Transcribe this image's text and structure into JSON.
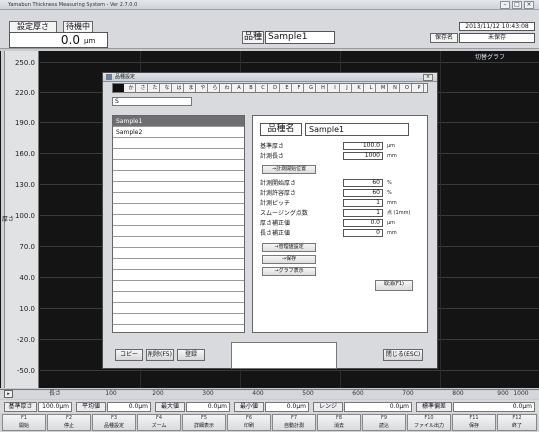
{
  "window": {
    "title": "Yamabun Thickness Measuring System - Ver 2.7.0.0"
  },
  "top": {
    "set_thickness_label": "設定厚さ",
    "set_thickness_value": "0.0",
    "set_thickness_unit": "μm",
    "state_badge": "待機中",
    "product_label": "品種",
    "product_value": "Sample1",
    "save_name_label": "保存名",
    "save_name_value": "未保存",
    "datetime": "2013/11/12 10:43:08",
    "graph_link": "切替グラフ"
  },
  "axis": {
    "y_title": "厚さ",
    "y_ticks": [
      "250.0",
      "220.0",
      "190.0",
      "160.0",
      "130.0",
      "100.0",
      "70.0",
      "40.0",
      "10.0",
      "-20.0",
      "-50.0"
    ],
    "x_title": "長さ",
    "x_ticks": [
      "100",
      "200",
      "300",
      "400",
      "500",
      "600",
      "700",
      "800",
      "900",
      "1000"
    ]
  },
  "status": [
    {
      "label": "基準厚さ",
      "value": "100.0μm"
    },
    {
      "label": "平均値",
      "value": "0.0μm"
    },
    {
      "label": "最大値",
      "value": "0.0μm"
    },
    {
      "label": "最小値",
      "value": "0.0μm"
    },
    {
      "label": "レンジ",
      "value": "0.0μm"
    },
    {
      "label": "標準偏差",
      "value": "0.0μm"
    }
  ],
  "fkeys": [
    {
      "n": "F1",
      "l": "開始"
    },
    {
      "n": "F2",
      "l": "停止"
    },
    {
      "n": "F3",
      "l": "品種設定"
    },
    {
      "n": "F4",
      "l": "ズーム"
    },
    {
      "n": "F5",
      "l": "詳細表示"
    },
    {
      "n": "F6",
      "l": "印刷"
    },
    {
      "n": "F7",
      "l": "自動計測"
    },
    {
      "n": "F8",
      "l": "消去"
    },
    {
      "n": "F9",
      "l": "読込"
    },
    {
      "n": "F10",
      "l": "ファイル出力"
    },
    {
      "n": "F11",
      "l": "保存"
    },
    {
      "n": "F12",
      "l": "終了"
    }
  ],
  "dialog": {
    "title": "品種設定",
    "tabs": [
      "あ",
      "か",
      "さ",
      "た",
      "な",
      "は",
      "ま",
      "や",
      "ら",
      "わ",
      "A",
      "B",
      "C",
      "D",
      "E",
      "F",
      "G",
      "H",
      "I",
      "J",
      "K",
      "L",
      "M",
      "N",
      "O",
      "P",
      "Q",
      "R",
      "S",
      "T",
      "U",
      "V",
      "W",
      "X",
      "Y",
      "Z"
    ],
    "search_value": "S",
    "items": [
      "Sample1",
      "Sample2"
    ],
    "detail": {
      "name_label": "品種名",
      "name_value": "Sample1",
      "fields": [
        {
          "label": "基準厚さ",
          "value": "100.0",
          "unit": "μm"
        },
        {
          "label": "計測長さ",
          "value": "1000",
          "unit": "mm"
        }
      ],
      "calc_button": "→計測開始位置",
      "fields2": [
        {
          "label": "計測開始厚さ",
          "value": "60",
          "unit": "%"
        },
        {
          "label": "計測許容厚さ",
          "value": "60",
          "unit": "%"
        },
        {
          "label": "計測ピッチ",
          "value": "1",
          "unit": "mm"
        },
        {
          "label": "スムージング点数",
          "value": "1",
          "unit": "点 (1mm)"
        },
        {
          "label": "厚さ補正値",
          "value": "0.0",
          "unit": "μm"
        },
        {
          "label": "長さ補正値",
          "value": "0",
          "unit": "mm"
        }
      ],
      "btn_rank": "→管理値設定",
      "btn_save": "→保存",
      "btn_show": "→グラフ表示",
      "btn_cancel": "取消(F1)"
    },
    "footer": {
      "copy": "コピー",
      "delete": "削除(F5)",
      "save": "登録",
      "close": "閉じる(ESC)"
    }
  }
}
